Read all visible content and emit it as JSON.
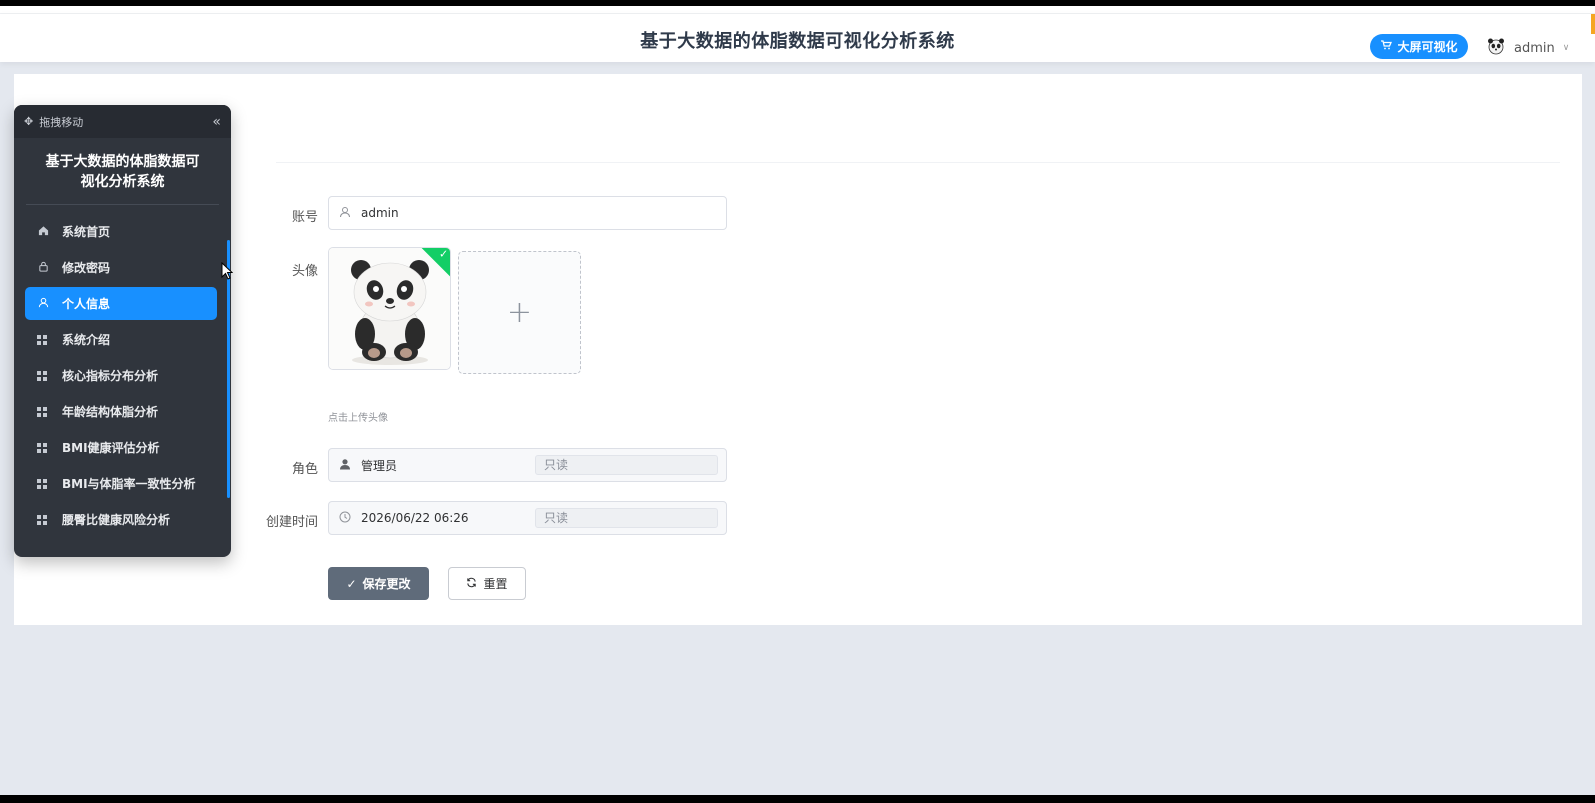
{
  "header": {
    "title": "基于大数据的体脂数据可视化分析系统",
    "bigscreen_label": "大屏可视化",
    "username": "admin"
  },
  "sidebar": {
    "drag_label": "拖拽移动",
    "title": "基于大数据的体脂数据可视化分析系统",
    "items": [
      {
        "label": "系统首页",
        "icon": "home-icon",
        "active": false
      },
      {
        "label": "修改密码",
        "icon": "lock-icon",
        "active": false
      },
      {
        "label": "个人信息",
        "icon": "user-icon",
        "active": true
      },
      {
        "label": "系统介绍",
        "icon": "grid-icon",
        "active": false
      },
      {
        "label": "核心指标分布分析",
        "icon": "grid-icon",
        "active": false
      },
      {
        "label": "年龄结构体脂分析",
        "icon": "grid-icon",
        "active": false
      },
      {
        "label": "BMI健康评估分析",
        "icon": "grid-icon",
        "active": false
      },
      {
        "label": "BMI与体脂率一致性分析",
        "icon": "grid-icon",
        "active": false
      },
      {
        "label": "腰臀比健康风险分析",
        "icon": "grid-icon",
        "active": false
      }
    ]
  },
  "form": {
    "account_label": "账号",
    "account_value": "admin",
    "avatar_label": "头像",
    "upload_tip": "点击上传头像",
    "role_label": "角色",
    "role_value": "管理员",
    "role_readonly": "只读",
    "created_label": "创建时间",
    "created_value": "2026/06/22 06:26",
    "created_readonly": "只读",
    "save_label": "保存更改",
    "reset_label": "重置"
  },
  "colors": {
    "accent": "#1890ff",
    "sidebar_bg": "#30353d",
    "save_bg": "#5f6b7a",
    "success": "#13ce66"
  }
}
